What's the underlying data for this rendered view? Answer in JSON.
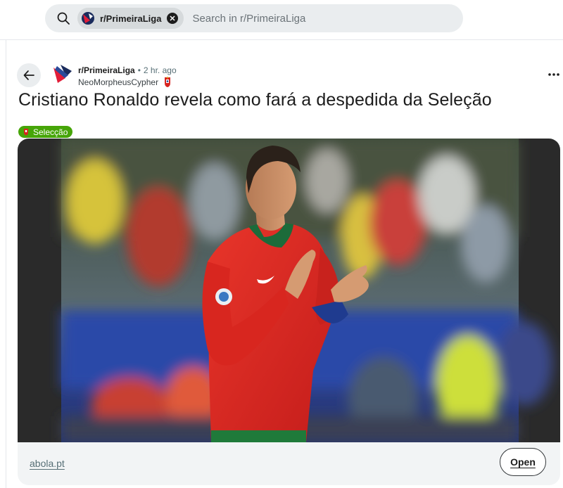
{
  "search": {
    "community_chip": "r/PrimeiraLiga",
    "placeholder": "Search in r/PrimeiraLiga"
  },
  "post": {
    "subreddit": "r/PrimeiraLiga",
    "separator": "•",
    "time_ago": "2 hr. ago",
    "author": "NeoMorpheusCypher",
    "title": "Cristiano Ronaldo revela como fará a despedida da Seleção",
    "flair": "Selecção",
    "link_domain": "abola.pt",
    "open_label": "Open"
  },
  "icons": {
    "search": "search-icon",
    "chip_close": "close-icon",
    "back": "arrow-left-icon",
    "more": "ellipsis-icon"
  },
  "colors": {
    "search_bg": "#eaedef",
    "flair_bg": "#46a508",
    "card_bg": "#f2f4f5",
    "jersey_red": "#d8231f"
  }
}
